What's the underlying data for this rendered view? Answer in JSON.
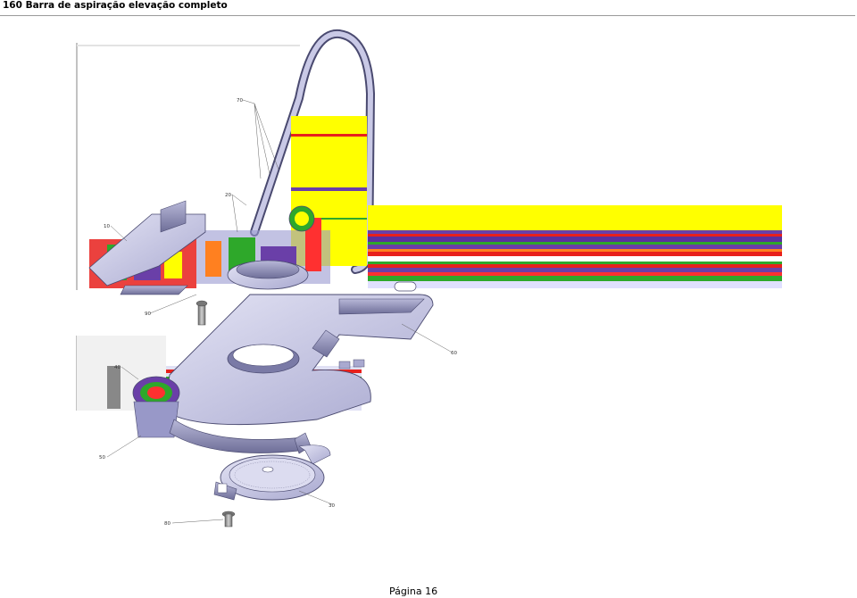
{
  "page": {
    "title": "160 Barra de aspiração elevação completo",
    "footer": "Página 16"
  },
  "drawing": {
    "callouts": {
      "c70": "70",
      "c20": "20",
      "c10": "10",
      "c90": "90",
      "c60": "60",
      "c40": "40",
      "c50": "50",
      "c30": "30",
      "c80": "80"
    },
    "colors": {
      "part_body": "#c9c9e6",
      "part_dark": "#8c8cb4",
      "part_edge": "#4a4a70",
      "bolt": "#8f8f8f",
      "artifact_yellow": "#ffff00",
      "artifact_purple": "#6a3fa8",
      "artifact_red": "#e8201c",
      "artifact_green": "#2ea82a"
    }
  }
}
